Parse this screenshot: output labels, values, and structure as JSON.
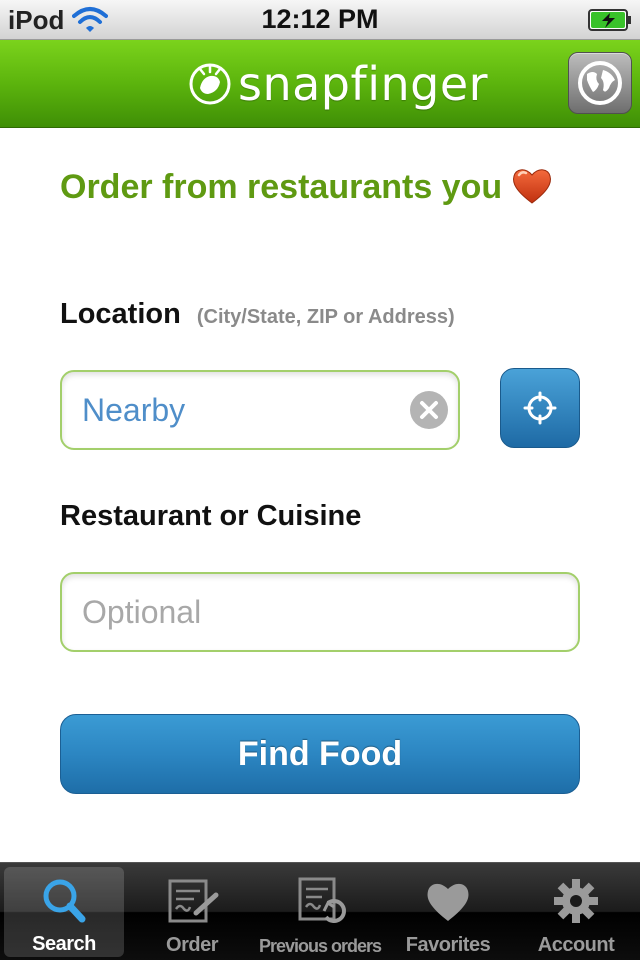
{
  "status_bar": {
    "carrier": "iPod",
    "time": "12:12 PM"
  },
  "header": {
    "brand": "snapfinger"
  },
  "tagline": "Order from restaurants you",
  "location": {
    "label": "Location",
    "hint": "(City/State, ZIP or Address)",
    "value": "Nearby"
  },
  "restaurant": {
    "label": "Restaurant or Cuisine",
    "placeholder": "Optional"
  },
  "find_button": "Find Food",
  "tabs": [
    {
      "label": "Search",
      "icon": "search-icon",
      "active": true
    },
    {
      "label": "Order",
      "icon": "order-icon",
      "active": false
    },
    {
      "label": "Previous orders",
      "icon": "previous-orders-icon",
      "active": false
    },
    {
      "label": "Favorites",
      "icon": "heart-icon",
      "active": false
    },
    {
      "label": "Account",
      "icon": "gear-icon",
      "active": false
    }
  ],
  "colors": {
    "header_green": "#5cb40d",
    "tagline_green": "#5f9a12",
    "button_blue": "#2c86c2",
    "field_border": "#a3cf6b",
    "heart_red": "#e0421e"
  }
}
